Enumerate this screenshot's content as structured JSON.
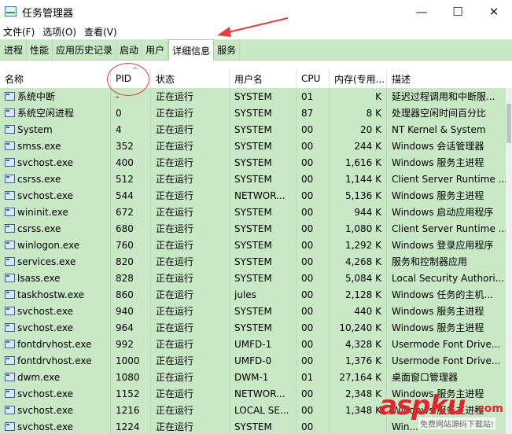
{
  "window": {
    "title": "任务管理器",
    "controls": [
      "—",
      "☐",
      "✕"
    ]
  },
  "menubar": [
    "文件(F)",
    "选项(O)",
    "查看(V)"
  ],
  "tabs": [
    {
      "label": "进程",
      "active": false
    },
    {
      "label": "性能",
      "active": false
    },
    {
      "label": "应用历史记录",
      "active": false
    },
    {
      "label": "启动",
      "active": false
    },
    {
      "label": "用户",
      "active": false
    },
    {
      "label": "详细信息",
      "active": true
    },
    {
      "label": "服务",
      "active": false
    }
  ],
  "columns": {
    "name": "名称",
    "pid": "PID",
    "status": "状态",
    "user": "用户名",
    "cpu": "CPU",
    "mem": "内存(专用...",
    "desc": "描述"
  },
  "rows": [
    {
      "name": "系统中断",
      "pid": "-",
      "status": "正在运行",
      "user": "SYSTEM",
      "cpu": "01",
      "mem": "K",
      "desc": "延迟过程调用和中断服..."
    },
    {
      "name": "系统空闲进程",
      "pid": "0",
      "status": "正在运行",
      "user": "SYSTEM",
      "cpu": "87",
      "mem": "8 K",
      "desc": "处理器空闲时间百分比"
    },
    {
      "name": "System",
      "pid": "4",
      "status": "正在运行",
      "user": "SYSTEM",
      "cpu": "00",
      "mem": "20 K",
      "desc": "NT Kernel & System"
    },
    {
      "name": "smss.exe",
      "pid": "352",
      "status": "正在运行",
      "user": "SYSTEM",
      "cpu": "00",
      "mem": "244 K",
      "desc": "Windows 会话管理器"
    },
    {
      "name": "svchost.exe",
      "pid": "400",
      "status": "正在运行",
      "user": "SYSTEM",
      "cpu": "00",
      "mem": "1,616 K",
      "desc": "Windows 服务主进程"
    },
    {
      "name": "csrss.exe",
      "pid": "512",
      "status": "正在运行",
      "user": "SYSTEM",
      "cpu": "00",
      "mem": "1,144 K",
      "desc": "Client Server Runtime ..."
    },
    {
      "name": "svchost.exe",
      "pid": "544",
      "status": "正在运行",
      "user": "NETWOR...",
      "cpu": "00",
      "mem": "5,136 K",
      "desc": "Windows 服务主进程"
    },
    {
      "name": "wininit.exe",
      "pid": "672",
      "status": "正在运行",
      "user": "SYSTEM",
      "cpu": "00",
      "mem": "944 K",
      "desc": "Windows 启动应用程序"
    },
    {
      "name": "csrss.exe",
      "pid": "680",
      "status": "正在运行",
      "user": "SYSTEM",
      "cpu": "00",
      "mem": "1,080 K",
      "desc": "Client Server Runtime ..."
    },
    {
      "name": "winlogon.exe",
      "pid": "760",
      "status": "正在运行",
      "user": "SYSTEM",
      "cpu": "00",
      "mem": "1,292 K",
      "desc": "Windows 登录应用程序"
    },
    {
      "name": "services.exe",
      "pid": "820",
      "status": "正在运行",
      "user": "SYSTEM",
      "cpu": "00",
      "mem": "4,268 K",
      "desc": "服务和控制器应用"
    },
    {
      "name": "lsass.exe",
      "pid": "828",
      "status": "正在运行",
      "user": "SYSTEM",
      "cpu": "00",
      "mem": "5,084 K",
      "desc": "Local Security Authori..."
    },
    {
      "name": "taskhostw.exe",
      "pid": "860",
      "status": "正在运行",
      "user": "jules",
      "cpu": "00",
      "mem": "2,128 K",
      "desc": "Windows 任务的主机..."
    },
    {
      "name": "svchost.exe",
      "pid": "940",
      "status": "正在运行",
      "user": "SYSTEM",
      "cpu": "00",
      "mem": "440 K",
      "desc": "Windows 服务主进程"
    },
    {
      "name": "svchost.exe",
      "pid": "964",
      "status": "正在运行",
      "user": "SYSTEM",
      "cpu": "00",
      "mem": "10,240 K",
      "desc": "Windows 服务主进程"
    },
    {
      "name": "fontdrvhost.exe",
      "pid": "992",
      "status": "正在运行",
      "user": "UMFD-1",
      "cpu": "00",
      "mem": "4,328 K",
      "desc": "Usermode Font Drive..."
    },
    {
      "name": "fontdrvhost.exe",
      "pid": "1000",
      "status": "正在运行",
      "user": "UMFD-0",
      "cpu": "00",
      "mem": "1,376 K",
      "desc": "Usermode Font Drive..."
    },
    {
      "name": "dwm.exe",
      "pid": "1080",
      "status": "正在运行",
      "user": "DWM-1",
      "cpu": "01",
      "mem": "27,164 K",
      "desc": "桌面窗口管理器"
    },
    {
      "name": "svchost.exe",
      "pid": "1152",
      "status": "正在运行",
      "user": "NETWOR...",
      "cpu": "00",
      "mem": "2,348 K",
      "desc": "Windows 服务主进程"
    },
    {
      "name": "svchost.exe",
      "pid": "1216",
      "status": "正在运行",
      "user": "LOCAL SE...",
      "cpu": "00",
      "mem": "1,348 K",
      "desc": "Windows 服务主进程"
    },
    {
      "name": "svchost.exe",
      "pid": "1224",
      "status": "正在运行",
      "user": "SYSTEM",
      "cpu": "00",
      "mem": "",
      "desc": "Win..."
    }
  ],
  "watermark": {
    "logo": "aspku",
    "tld": ".com",
    "sub": "免费网站源码下载站!"
  },
  "colors": {
    "highlight": "#c9e8c6",
    "annotation": "#e14040",
    "watermark": "#e0262b"
  }
}
